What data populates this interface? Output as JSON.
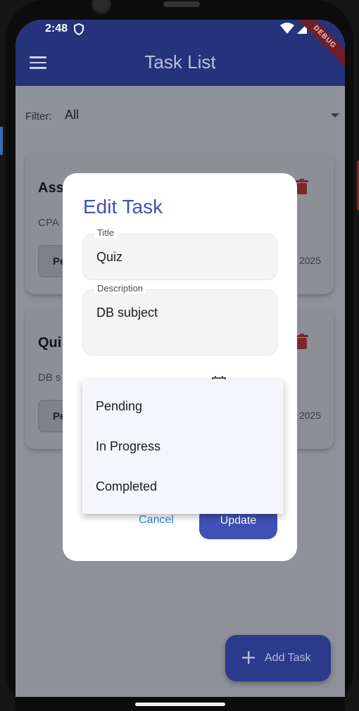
{
  "status_bar": {
    "time": "2:48"
  },
  "app_bar": {
    "title": "Task List",
    "debug_banner": "DEBUG"
  },
  "filter": {
    "label": "Filter:",
    "value": "All"
  },
  "tasks": [
    {
      "title": "Ass",
      "description": "CPA",
      "status": "Pe",
      "date": "2025"
    },
    {
      "title": "Qui",
      "description": "DB s",
      "status": "Pe",
      "date": "2025"
    }
  ],
  "fab": {
    "label": "Add Task"
  },
  "dialog": {
    "title": "Edit Task",
    "title_field": {
      "label": "Title",
      "value": "Quiz"
    },
    "description_field": {
      "label": "Description",
      "value": "DB subject"
    },
    "cancel_label": "Cancel",
    "update_label": "Update"
  },
  "status_dropdown": {
    "options": [
      "Pending",
      "In Progress",
      "Completed"
    ]
  },
  "colors": {
    "primary": "#3f51b5",
    "app_bar": "#24337a",
    "delete": "#c62828",
    "link": "#2f86d6"
  }
}
